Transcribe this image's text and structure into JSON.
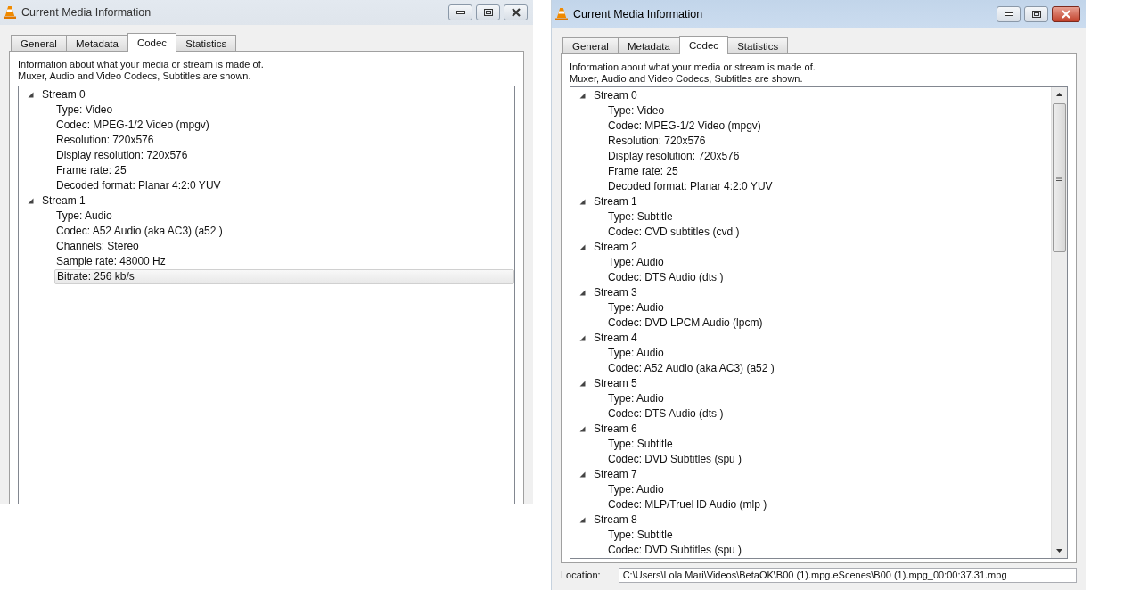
{
  "windows": [
    {
      "title": "Current Media Information",
      "active": false,
      "scrollbar": false,
      "tabs": [
        {
          "label": "General",
          "selected": false
        },
        {
          "label": "Metadata",
          "selected": false
        },
        {
          "label": "Codec",
          "selected": true
        },
        {
          "label": "Statistics",
          "selected": false
        }
      ],
      "description": [
        "Information about what your media or stream is made of.",
        "Muxer, Audio and Video Codecs, Subtitles are shown."
      ],
      "tree": [
        {
          "label": "Stream 0",
          "expanded": true,
          "selected": false,
          "children": [
            {
              "label": "Type: Video",
              "selected": false
            },
            {
              "label": "Codec: MPEG-1/2 Video (mpgv)",
              "selected": false
            },
            {
              "label": "Resolution: 720x576",
              "selected": false
            },
            {
              "label": "Display resolution: 720x576",
              "selected": false
            },
            {
              "label": "Frame rate: 25",
              "selected": false
            },
            {
              "label": "Decoded format: Planar 4:2:0 YUV",
              "selected": false
            }
          ]
        },
        {
          "label": "Stream 1",
          "expanded": true,
          "selected": false,
          "children": [
            {
              "label": "Type: Audio",
              "selected": false
            },
            {
              "label": "Codec: A52 Audio (aka AC3) (a52 )",
              "selected": false
            },
            {
              "label": "Channels: Stereo",
              "selected": false
            },
            {
              "label": "Sample rate: 48000 Hz",
              "selected": false
            },
            {
              "label": "Bitrate: 256 kb/s",
              "selected": true
            }
          ]
        }
      ]
    },
    {
      "title": "Current Media Information",
      "active": true,
      "scrollbar": true,
      "tabs": [
        {
          "label": "General",
          "selected": false
        },
        {
          "label": "Metadata",
          "selected": false
        },
        {
          "label": "Codec",
          "selected": true
        },
        {
          "label": "Statistics",
          "selected": false
        }
      ],
      "description": [
        "Information about what your media or stream is made of.",
        "Muxer, Audio and Video Codecs, Subtitles are shown."
      ],
      "tree": [
        {
          "label": "Stream 0",
          "expanded": true,
          "selected": false,
          "children": [
            {
              "label": "Type: Video",
              "selected": false
            },
            {
              "label": "Codec: MPEG-1/2 Video (mpgv)",
              "selected": false
            },
            {
              "label": "Resolution: 720x576",
              "selected": false
            },
            {
              "label": "Display resolution: 720x576",
              "selected": false
            },
            {
              "label": "Frame rate: 25",
              "selected": false
            },
            {
              "label": "Decoded format: Planar 4:2:0 YUV",
              "selected": false
            }
          ]
        },
        {
          "label": "Stream 1",
          "expanded": true,
          "selected": false,
          "children": [
            {
              "label": "Type: Subtitle",
              "selected": false
            },
            {
              "label": "Codec: CVD subtitles (cvd )",
              "selected": false
            }
          ]
        },
        {
          "label": "Stream 2",
          "expanded": true,
          "selected": false,
          "children": [
            {
              "label": "Type: Audio",
              "selected": false
            },
            {
              "label": "Codec: DTS Audio (dts )",
              "selected": false
            }
          ]
        },
        {
          "label": "Stream 3",
          "expanded": true,
          "selected": false,
          "children": [
            {
              "label": "Type: Audio",
              "selected": false
            },
            {
              "label": "Codec: DVD LPCM Audio (lpcm)",
              "selected": false
            }
          ]
        },
        {
          "label": "Stream 4",
          "expanded": true,
          "selected": false,
          "children": [
            {
              "label": "Type: Audio",
              "selected": false
            },
            {
              "label": "Codec: A52 Audio (aka AC3) (a52 )",
              "selected": false
            }
          ]
        },
        {
          "label": "Stream 5",
          "expanded": true,
          "selected": false,
          "children": [
            {
              "label": "Type: Audio",
              "selected": false
            },
            {
              "label": "Codec: DTS Audio (dts )",
              "selected": false
            }
          ]
        },
        {
          "label": "Stream 6",
          "expanded": true,
          "selected": false,
          "children": [
            {
              "label": "Type: Subtitle",
              "selected": false
            },
            {
              "label": "Codec: DVD Subtitles (spu )",
              "selected": false
            }
          ]
        },
        {
          "label": "Stream 7",
          "expanded": true,
          "selected": false,
          "children": [
            {
              "label": "Type: Audio",
              "selected": false
            },
            {
              "label": "Codec: MLP/TrueHD Audio (mlp )",
              "selected": false
            }
          ]
        },
        {
          "label": "Stream 8",
          "expanded": true,
          "selected": false,
          "children": [
            {
              "label": "Type: Subtitle",
              "selected": false
            },
            {
              "label": "Codec: DVD Subtitles (spu )",
              "selected": false
            }
          ]
        }
      ],
      "location": {
        "label": "Location:",
        "value": "C:\\Users\\Lola Mari\\Videos\\BetaOK\\B00 (1).mpg.eScenes\\B00 (1).mpg_00:00:37.31.mpg"
      }
    }
  ]
}
